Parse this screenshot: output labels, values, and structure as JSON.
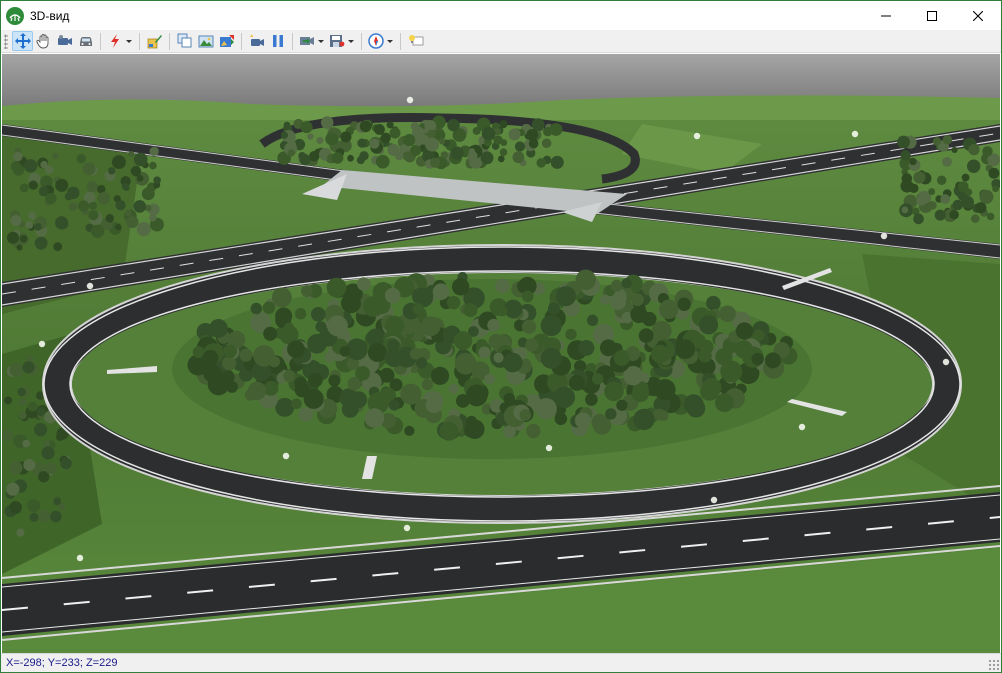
{
  "window": {
    "title": "3D-вид",
    "controls": [
      "minimize",
      "maximize",
      "close"
    ]
  },
  "toolbar": {
    "buttons": [
      {
        "name": "pan-move-icon",
        "active": true
      },
      {
        "name": "hand-icon"
      },
      {
        "name": "camera-icon"
      },
      {
        "name": "car-icon"
      },
      {
        "name": "lightning-icon",
        "dropdown": true
      },
      {
        "name": "layers-brush-icon"
      },
      {
        "name": "copy-view-icon"
      },
      {
        "name": "landscape-icon"
      },
      {
        "name": "paint-scene-icon"
      },
      {
        "name": "record-camera-icon"
      },
      {
        "name": "pause-icon"
      },
      {
        "name": "export-video-icon",
        "dropdown": true
      },
      {
        "name": "save-image-icon",
        "dropdown": true
      },
      {
        "name": "compass-icon",
        "dropdown": true
      },
      {
        "name": "lightbulb-icon"
      }
    ]
  },
  "status": {
    "x_label": "X=",
    "x_value": "-298",
    "y_label": "; Y=",
    "y_value": "233",
    "z_label": "; Z=",
    "z_value": "229"
  },
  "colors": {
    "title_bar": "#ffffff",
    "toolbar": "#f0f0f0",
    "window_border": "#2f7f3a",
    "sky": "#8c8c8c",
    "grass": "#56803a",
    "asphalt": "#2d2f30",
    "coordinates_text": "#1a1a8a"
  }
}
